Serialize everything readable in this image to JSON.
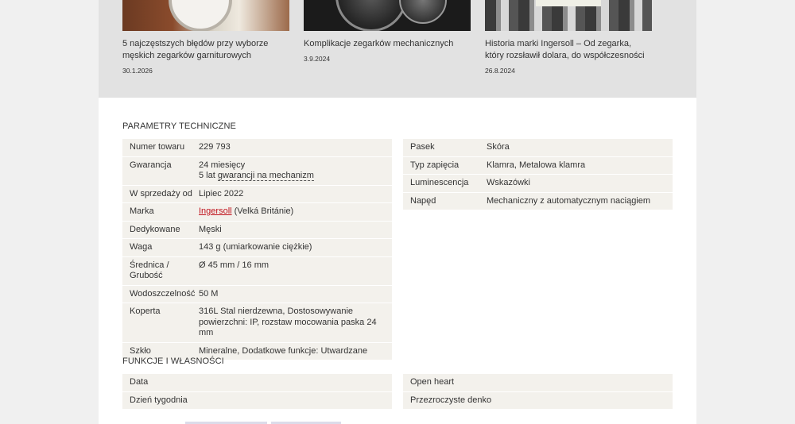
{
  "articles": [
    {
      "title": "5 najczęstszych błędów przy wyborze męskich zegarków garniturowych",
      "date": "30.1.2026"
    },
    {
      "title": "Komplikacje zegarków mechanicznych",
      "date": "3.9.2024"
    },
    {
      "title": "Historia marki Ingersoll – Od zegarka, który rozsławił dolara, do współczesności",
      "date": "26.8.2024"
    }
  ],
  "tech": {
    "heading": "PARAMETRY TECHNICZNE",
    "left": [
      {
        "label": "Numer towaru",
        "value": "229 793"
      },
      {
        "label": "Gwarancja",
        "value": "24 miesięcy",
        "value2_prefix": "5 lat ",
        "value2_link": "gwarancji na mechanizm"
      },
      {
        "label": "W sprzedaży od",
        "value": "Lipiec 2022"
      },
      {
        "label": "Marka",
        "value_link": "Ingersoll",
        "value_suffix": " (Velká Británie)"
      },
      {
        "label": "Dedykowane",
        "value": "Męski"
      },
      {
        "label": "Waga",
        "value": "143 g (umiarkowanie ciężkie)"
      },
      {
        "label": "Średnica / Grubość",
        "value": "Ø 45 mm / 16 mm"
      },
      {
        "label": "Wodoszczelność",
        "value": "50 M"
      },
      {
        "label": "Koperta",
        "value": "316L Stal nierdzewna, Dostosowywanie powierzchni: IP, rozstaw mocowania paska 24 mm"
      },
      {
        "label": "Szkło",
        "value": "Mineralne, Dodatkowe funkcje: Utwardzane"
      }
    ],
    "right": [
      {
        "label": "Pasek",
        "value": "Skóra"
      },
      {
        "label": "Typ zapięcia",
        "value": "Klamra, Metalowa klamra"
      },
      {
        "label": "Luminescencja",
        "value": "Wskazówki"
      },
      {
        "label": "Napęd",
        "value": "Mechaniczny z automatycznym naciągiem"
      }
    ]
  },
  "features": {
    "heading": "FUNKCJE I WŁASNOŚCI",
    "left": [
      "Data",
      "Dzień tygodnia"
    ],
    "right": [
      "Open heart",
      "Przezroczyste denko"
    ]
  }
}
